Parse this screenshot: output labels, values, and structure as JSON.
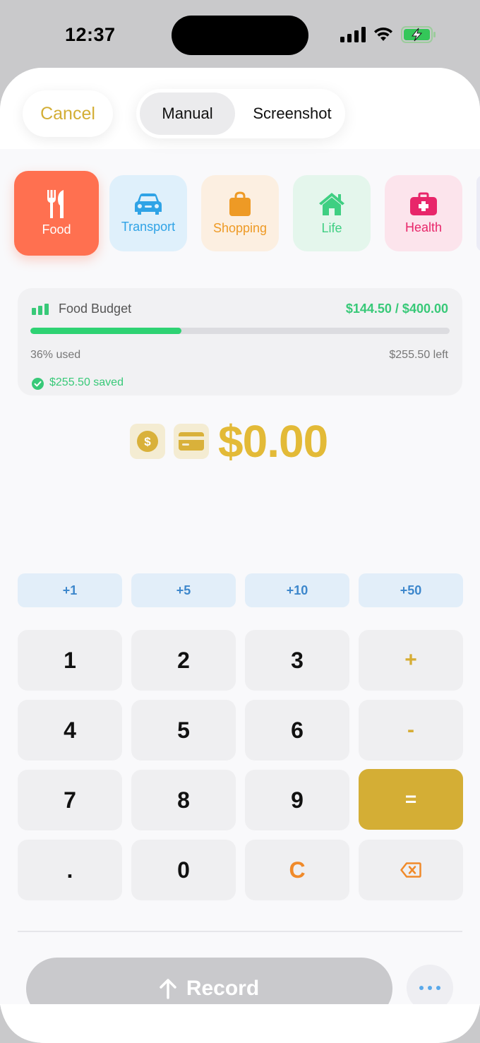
{
  "status": {
    "time": "12:37"
  },
  "header": {
    "cancel_label": "Cancel",
    "segments": [
      {
        "label": "Manual",
        "selected": true
      },
      {
        "label": "Screenshot",
        "selected": false
      }
    ]
  },
  "categories": [
    {
      "label": "Food",
      "icon": "fork-knife-icon",
      "selected": true,
      "bg": "#ff7050",
      "fg": "#ffffff"
    },
    {
      "label": "Transport",
      "icon": "car-icon",
      "selected": false,
      "bg": "#dff0fb",
      "fg": "#2fa3e6"
    },
    {
      "label": "Shopping",
      "icon": "shopping-bag-icon",
      "selected": false,
      "bg": "#fcefe1",
      "fg": "#ee9a25"
    },
    {
      "label": "Life",
      "icon": "house-icon",
      "selected": false,
      "bg": "#e4f6ec",
      "fg": "#3fcf82"
    },
    {
      "label": "Health",
      "icon": "medical-kit-icon",
      "selected": false,
      "bg": "#fce4ec",
      "fg": "#e8266a"
    }
  ],
  "budget": {
    "title": "Food Budget",
    "amount_text": "$144.50 / $400.00",
    "progress_percent": 36,
    "used_text": "36% used",
    "left_text": "$255.50 left",
    "saved_text": "$255.50 saved"
  },
  "amount": {
    "value": "$0.00"
  },
  "quick_add": [
    "+1",
    "+5",
    "+10",
    "+50"
  ],
  "keypad": {
    "rows": [
      [
        "1",
        "2",
        "3",
        "+"
      ],
      [
        "4",
        "5",
        "6",
        "-"
      ],
      [
        "7",
        "8",
        "9",
        "="
      ],
      [
        ".",
        "0",
        "C",
        "backspace"
      ]
    ]
  },
  "footer": {
    "record_label": "Record"
  },
  "colors": {
    "accent": "#d4ae35",
    "budget_green": "#2ed273",
    "quick_blue": "#3d87cc",
    "clear_orange": "#f08a2a"
  }
}
